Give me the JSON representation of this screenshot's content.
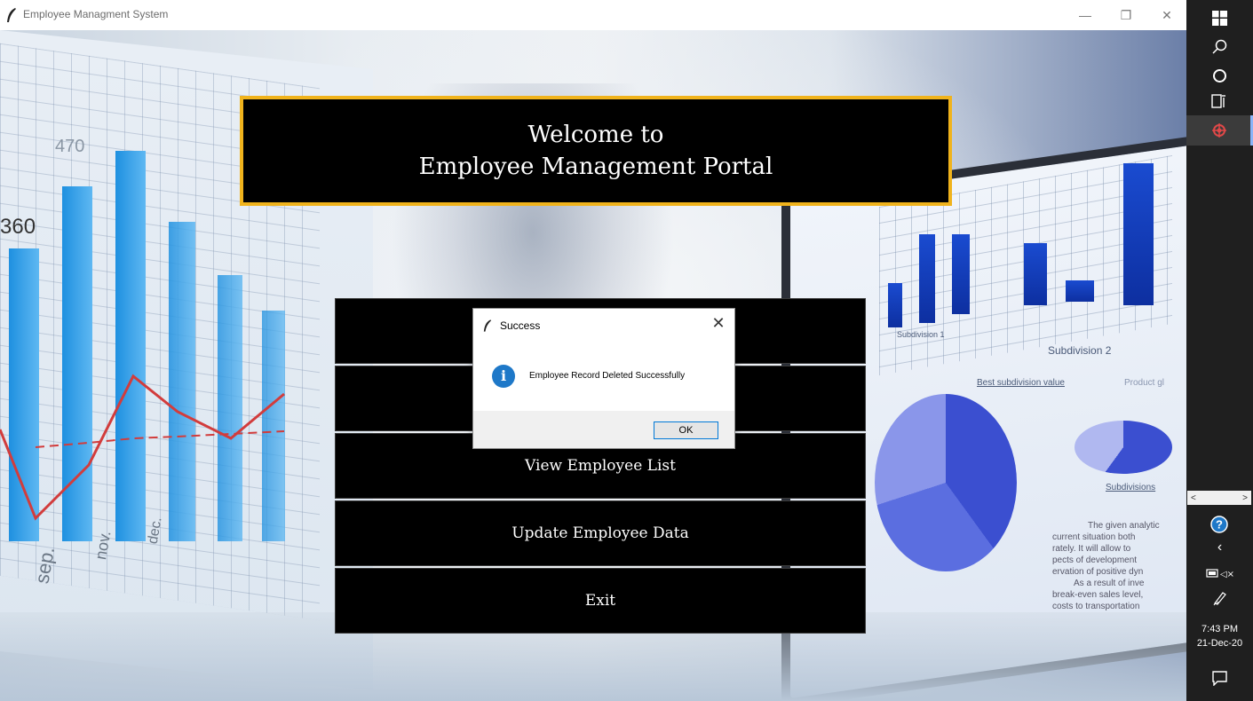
{
  "window": {
    "title": "Employee Managment System",
    "controls": {
      "minimize": "—",
      "maximize": "❐",
      "close": "✕"
    }
  },
  "background": {
    "left_axis_labels": [
      "sep.",
      "nov.",
      "dec."
    ],
    "left_numbers": [
      "470",
      "360"
    ],
    "right_monitor_text": {
      "subdivision1": "Subdivision 1",
      "subdivision2": "Subdivision 2",
      "best": "Best subdivision value",
      "product": "Product gl",
      "subdivisions": "Subdivisions",
      "paragraph": [
        "The given analytic",
        "current situation both",
        "rately. It will allow to",
        "pects of development",
        "ervation of positive dyn",
        "As a result of inve",
        "break-even sales level,",
        "costs to transportation"
      ]
    }
  },
  "banner": {
    "line1": "Welcome to",
    "line2": "Employee Management Portal"
  },
  "menu": {
    "view_list": "View Employee List",
    "update": "Update Employee Data",
    "exit": "Exit"
  },
  "dialog": {
    "title": "Success",
    "close": "✕",
    "icon": "i",
    "message": "Employee Record Deleted Successfully",
    "ok_label": "OK"
  },
  "taskbar": {
    "icons": [
      "windows-icon",
      "search-icon",
      "cortana-icon",
      "task-view-icon",
      "app-icon",
      "help-icon",
      "chevron-left-icon",
      "battery-icon",
      "pen-icon",
      "notification-icon"
    ],
    "time": "7:43 PM",
    "date": "21-Dec-20",
    "scroll_left": "<",
    "scroll_right": ">"
  },
  "colors": {
    "banner_border": "#f0b31c",
    "button_bg": "#000000",
    "info_blue": "#1e78c8",
    "taskbar": "#1f1f1f"
  }
}
